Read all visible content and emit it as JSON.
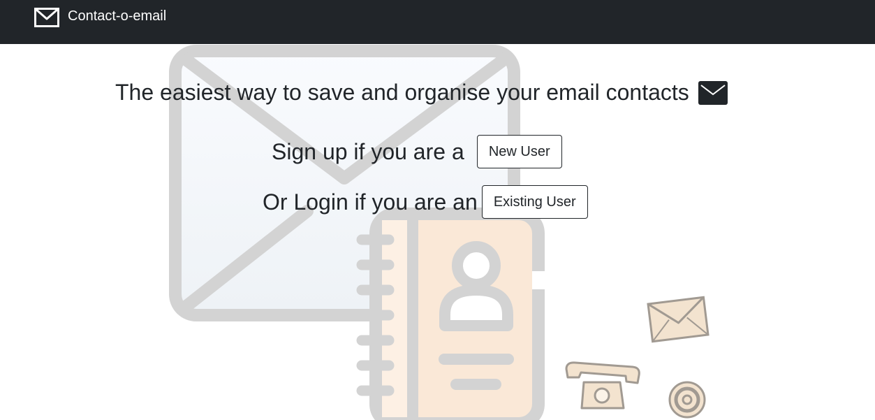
{
  "navbar": {
    "brand_icon": "envelope-outline-icon",
    "brand_text": "Contact-o-email"
  },
  "hero": {
    "headline": "The easiest way to save and organise your email contacts",
    "headline_icon": "envelope-filled-icon",
    "signup_prompt": "Sign up if you are a",
    "signup_button": "New User",
    "login_prompt": "Or Login if you are an",
    "login_button": "Existing User"
  },
  "illustration": {
    "items": [
      "large-envelope-icon",
      "address-book-icon",
      "small-envelope-icon",
      "telephone-icon",
      "at-sign-icon"
    ]
  },
  "colors": {
    "navbar_bg": "#212529",
    "text": "#212529",
    "illustration_gray": "#d3d3d3",
    "address_book_fill": "#fae8d7"
  }
}
